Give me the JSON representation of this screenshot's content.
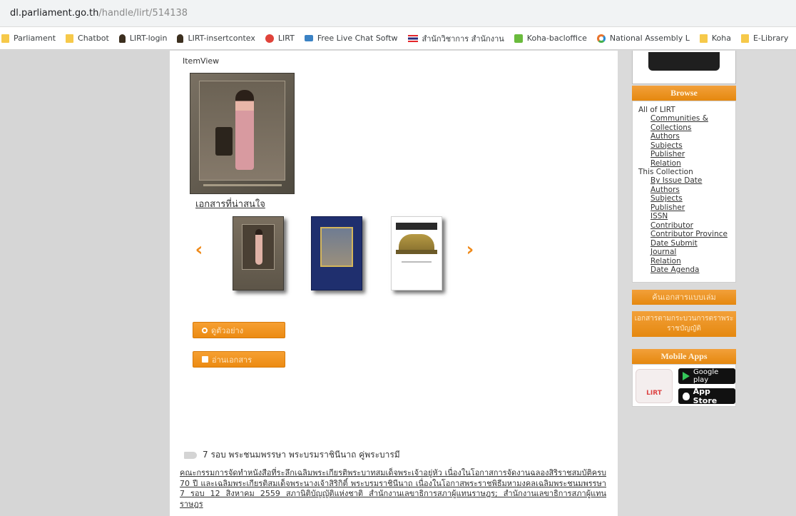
{
  "browser": {
    "url_host": "dl.parliament.go.th",
    "url_path": "/handle/lirt/514138",
    "bookmarks": [
      {
        "label": "Parliament",
        "icon": "folder-icon"
      },
      {
        "label": "Chatbot",
        "icon": "folder-icon"
      },
      {
        "label": "LIRT-login",
        "icon": "person-icon"
      },
      {
        "label": "LIRT-insertcontex",
        "icon": "person-icon"
      },
      {
        "label": "LIRT",
        "icon": "red-circle-icon"
      },
      {
        "label": "Free Live Chat Softw",
        "icon": "chat-icon"
      },
      {
        "label": "สำนักวิชาการ สำนักงาน",
        "icon": "thai-flag-icon"
      },
      {
        "label": "Koha-bacloffice",
        "icon": "koha-icon"
      },
      {
        "label": "National Assembly L",
        "icon": "globe-icon"
      },
      {
        "label": "Koha",
        "icon": "folder-icon"
      },
      {
        "label": "E-Library",
        "icon": "folder-icon"
      }
    ]
  },
  "main": {
    "itemview_label": "ItemView",
    "interest_link": "เอกสารที่น่าสนใจ",
    "buttons": {
      "preview": "ดูตัวอย่าง",
      "read": "อ่านเอกสาร"
    },
    "subject": "7 รอบ พระชนมพรรษา พระบรมราชินีนาถ คู่พระบารมี",
    "description": "คณะกรรมการจัดทำหนังสือที่ระลึกเฉลิมพระเกียรติพระบาทสมเด็จพระเจ้าอยู่หัว เนื่องในโอกาสการจัดงานฉลองสิริราชสมบัติครบ 70 ปี และเฉลิมพระเกียรติสมเด็จพระนางเจ้าสิริกิติ์ พระบรมราชินีนาถ เนื่องในโอกาสพระราชพิธีมหามงคลเฉลิมพระชนมพรรษา 7 รอบ 12 สิงหาคม 2559 สภานิติบัญญัติแห่งชาติ สำนักงานเลขาธิการสภาผู้แทนราษฎร; สำนักงานเลขาธิการสภาผู้แทนราษฎร",
    "carousel": {
      "thumb3_title": "Academic Focus"
    }
  },
  "sidebar": {
    "browse_title": "Browse",
    "all_label": "All of LIRT",
    "all_links": [
      "Communities &",
      "Collections",
      "Authors",
      "Subjects",
      "Publisher",
      "Relation"
    ],
    "collection_label": "This Collection",
    "collection_links": [
      "By Issue Date",
      "Authors",
      "Subjects",
      "Publisher",
      "ISSN",
      "Contributor",
      "Contributor Province",
      "Date Submit",
      "Journal",
      "Relation",
      "Date Agenda"
    ],
    "search_bar": "ค้นเอกสารแบบเล่ม",
    "legis_bar": "เอกสารตามกระบวนการตราพระราชบัญญัติ",
    "apps_title": "Mobile Apps",
    "lirt_logo_text": "LIRT",
    "google_play": "Google play",
    "app_store": "App Store"
  }
}
